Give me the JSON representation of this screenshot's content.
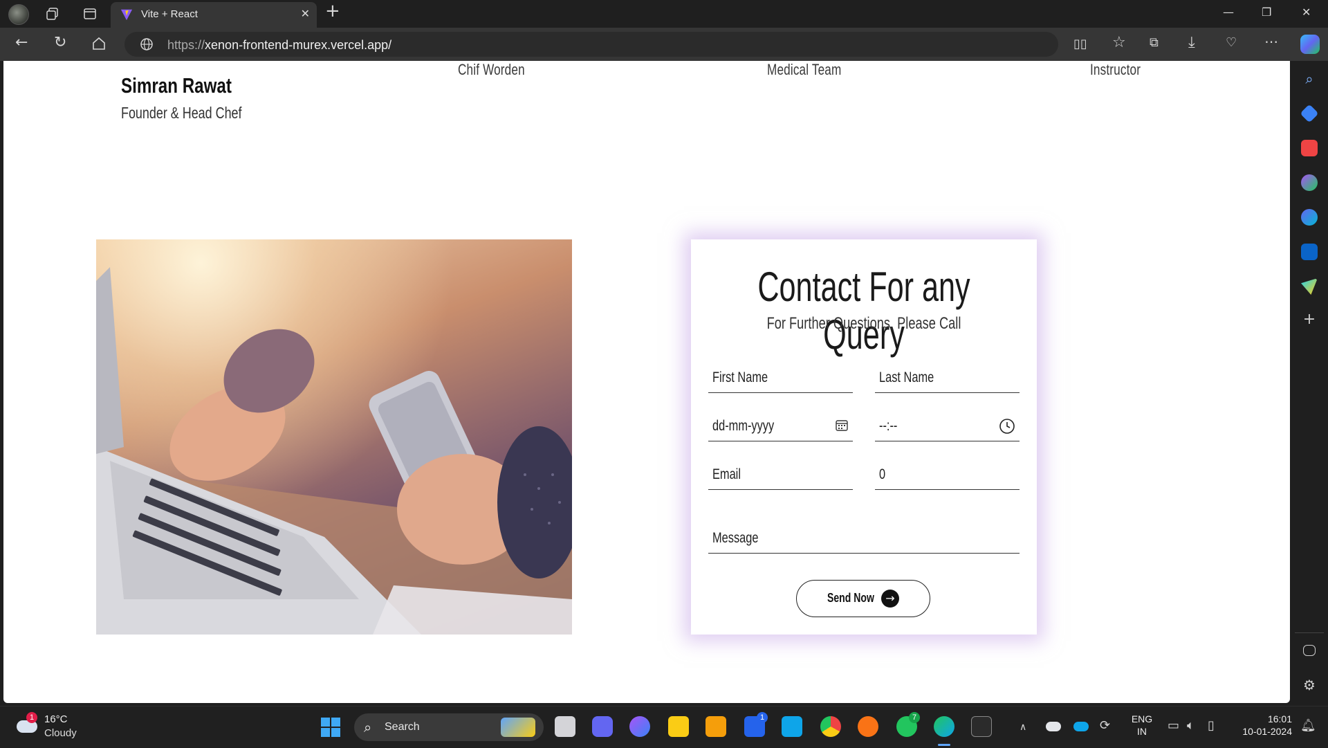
{
  "browser": {
    "tab_title": "Vite + React",
    "new_tab": "+",
    "url_scheme": "https://",
    "url_host": "xenon-frontend-murex.vercel.app/",
    "window_controls": [
      "minimize",
      "restore",
      "close"
    ]
  },
  "page": {
    "team_labels": [
      "Chif Worden",
      "Medical Team",
      "Instructor"
    ],
    "chef": {
      "name": "Simran Rawat",
      "role": "Founder & Head Chef"
    },
    "contact": {
      "title": "Contact For any Query",
      "subtitle": "For Further Questions, Please Call",
      "first_name_placeholder": "First Name",
      "last_name_placeholder": "Last Name",
      "date_placeholder": "dd-mm-yyyy",
      "time_placeholder": "--:--",
      "email_placeholder": "Email",
      "phone_value": "0",
      "message_placeholder": "Message",
      "send_label": "Send Now"
    },
    "accent_colors": {
      "card_glow": "#c4a4e6"
    }
  },
  "taskbar": {
    "weather_temp": "16°C",
    "weather_cond": "Cloudy",
    "weather_badge": "1",
    "search_label": "Search",
    "vscode_badge": "1",
    "whatsapp_badge": "7",
    "lang_line1": "ENG",
    "lang_line2": "IN",
    "time": "16:01",
    "date": "10-01-2024"
  }
}
